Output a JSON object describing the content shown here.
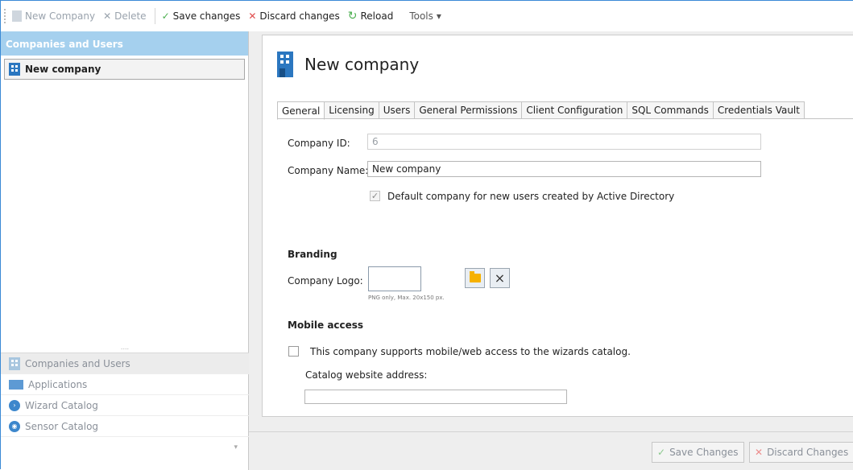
{
  "toolbar": {
    "new_company": "New Company",
    "delete": "Delete",
    "save_changes": "Save changes",
    "discard_changes": "Discard changes",
    "reload": "Reload",
    "tools": "Tools"
  },
  "sidebar": {
    "header": "Companies and Users",
    "tree_items": [
      "New company"
    ],
    "splitter_dots": "....",
    "nav_items": [
      {
        "label": "Companies and Users",
        "icon": "building-icon"
      },
      {
        "label": "Applications",
        "icon": "applications-icon"
      },
      {
        "label": "Wizard Catalog",
        "icon": "wizard-catalog-icon"
      },
      {
        "label": "Sensor Catalog",
        "icon": "sensor-catalog-icon"
      }
    ],
    "foot_chevron": "▾"
  },
  "main": {
    "title": "New company",
    "tabs": [
      "General",
      "Licensing",
      "Users",
      "General Permissions",
      "Client Configuration",
      "SQL Commands",
      "Credentials Vault"
    ],
    "active_tab": "General",
    "company_id_label": "Company ID:",
    "company_id_value": "6",
    "company_name_label": "Company Name:",
    "company_name_value": "New company",
    "default_company_label": "Default company for new users created by Active Directory",
    "default_company_checked": true,
    "branding_heading": "Branding",
    "company_logo_label": "Company Logo:",
    "logo_hint": "PNG only, Max. 20x150 px.",
    "mobile_heading": "Mobile access",
    "mobile_support_label": "This company supports mobile/web access to the wizards catalog.",
    "mobile_support_checked": false,
    "catalog_address_label": "Catalog website address:",
    "catalog_address_value": ""
  },
  "footer": {
    "save_label": "Save Changes",
    "discard_label": "Discard Changes"
  },
  "colors": {
    "accent": "#2b77c0",
    "sidebar_header": "#a5d0ee",
    "success": "#4caf50",
    "danger": "#e04b4b",
    "folder": "#f6b100"
  }
}
